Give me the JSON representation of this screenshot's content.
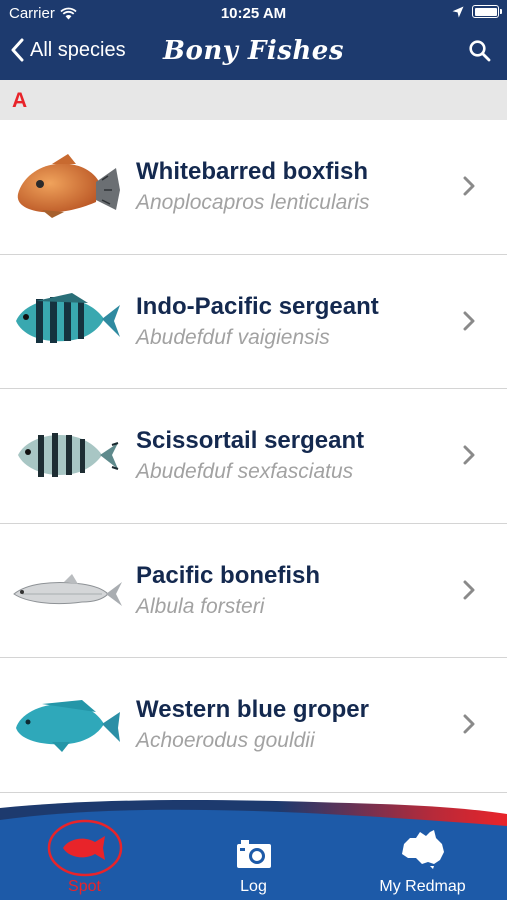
{
  "status_bar": {
    "carrier": "Carrier",
    "time": "10:25 AM",
    "icons": [
      "wifi-icon",
      "location-arrow-icon",
      "battery-icon"
    ]
  },
  "nav": {
    "back_label": "All species",
    "title": "Bony Fishes",
    "search_icon": "search-icon"
  },
  "section": {
    "letter": "A"
  },
  "species": [
    {
      "common": "Whitebarred boxfish",
      "scientific": "Anoplocapros lenticularis",
      "image": "orange-boxfish"
    },
    {
      "common": "Indo-Pacific sergeant",
      "scientific": "Abudefduf vaigiensis",
      "image": "striped-blue-sergeant"
    },
    {
      "common": "Scissortail sergeant",
      "scientific": "Abudefduf sexfasciatus",
      "image": "striped-grey-sergeant"
    },
    {
      "common": "Pacific bonefish",
      "scientific": "Albula forsteri",
      "image": "silver-bonefish"
    },
    {
      "common": "Western blue groper",
      "scientific": "Achoerodus gouldii",
      "image": "blue-groper"
    }
  ],
  "tabs": [
    {
      "label": "Spot",
      "icon": "fish-icon",
      "active": true
    },
    {
      "label": "Log",
      "icon": "camera-icon",
      "active": false
    },
    {
      "label": "My Redmap",
      "icon": "australia-map-icon",
      "active": false
    }
  ],
  "colors": {
    "nav_background": "#1d3a6e",
    "accent_red": "#e8242a",
    "title_navy": "#14294f",
    "subtitle_grey": "#a2a2a2",
    "section_background": "#e7e7e7"
  }
}
